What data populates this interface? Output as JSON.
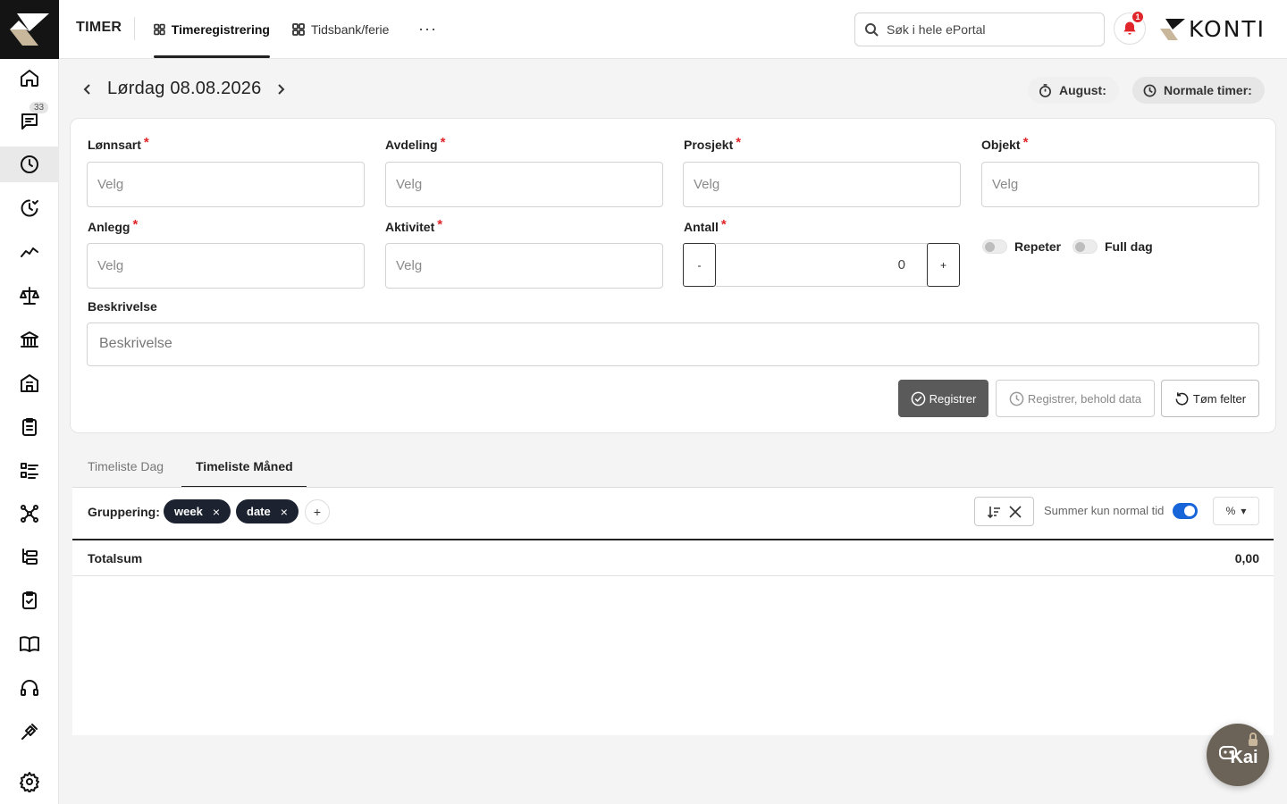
{
  "header": {
    "app_title": "TIMER",
    "tabs": [
      {
        "label": "Timeregistrering",
        "icon": "grid-icon",
        "active": true
      },
      {
        "label": "Tidsbank/ferie",
        "icon": "grid-icon",
        "active": false
      }
    ],
    "more_label": "···",
    "search_placeholder": "Søk i hele ePortal",
    "notification_count": "1",
    "brand_name": "KONTI"
  },
  "sidebar": {
    "chat_badge": "33",
    "items": [
      {
        "name": "home-icon"
      },
      {
        "name": "chat-icon"
      },
      {
        "name": "clock-icon",
        "active": true
      },
      {
        "name": "clock-check-icon"
      },
      {
        "name": "trend-icon"
      },
      {
        "name": "scale-icon"
      },
      {
        "name": "bank-icon"
      },
      {
        "name": "building-icon"
      },
      {
        "name": "clipboard-list-icon"
      },
      {
        "name": "list-icon"
      },
      {
        "name": "network-icon"
      },
      {
        "name": "tree-icon"
      },
      {
        "name": "clipboard-check-icon"
      },
      {
        "name": "book-icon"
      },
      {
        "name": "headset-icon"
      },
      {
        "name": "plug-icon"
      },
      {
        "name": "gear-icon"
      }
    ]
  },
  "date_nav": {
    "title": "Lørdag 08.08.2026",
    "month_pill": "August:",
    "normal_hours_pill": "Normale timer:"
  },
  "form": {
    "fields": {
      "lonnsart": {
        "label": "Lønnsart",
        "placeholder": "Velg"
      },
      "avdeling": {
        "label": "Avdeling",
        "placeholder": "Velg"
      },
      "prosjekt": {
        "label": "Prosjekt",
        "placeholder": "Velg"
      },
      "objekt": {
        "label": "Objekt",
        "placeholder": "Velg"
      },
      "anlegg": {
        "label": "Anlegg",
        "placeholder": "Velg"
      },
      "aktivitet": {
        "label": "Aktivitet",
        "placeholder": "Velg"
      },
      "antall": {
        "label": "Antall",
        "value": "0",
        "minus": "-",
        "plus": "+"
      }
    },
    "required_mark": "*",
    "toggles": {
      "repeter": "Repeter",
      "full_dag": "Full dag"
    },
    "description": {
      "label": "Beskrivelse",
      "placeholder": "Beskrivelse"
    },
    "buttons": {
      "register": "Registrer",
      "register_keep": "Registrer, behold data",
      "clear": "Tøm felter"
    }
  },
  "timeliste": {
    "tabs": [
      {
        "label": "Timeliste Dag",
        "active": false
      },
      {
        "label": "Timeliste Måned",
        "active": true
      }
    ],
    "grouping_label": "Gruppering:",
    "chips": [
      "week",
      "date"
    ],
    "chip_remove": "×",
    "add_label": "+",
    "sum_normal_label": "Summer kun normal tid",
    "sum_normal_on": true,
    "percent_label": "%",
    "total_label": "Totalsum",
    "total_value": "0,00"
  },
  "assistant": {
    "label": "Kai"
  },
  "colors": {
    "accent": "#1765d8",
    "danger": "#e0262b",
    "chip": "#1c2230",
    "primary_button": "#5a5a5a"
  }
}
